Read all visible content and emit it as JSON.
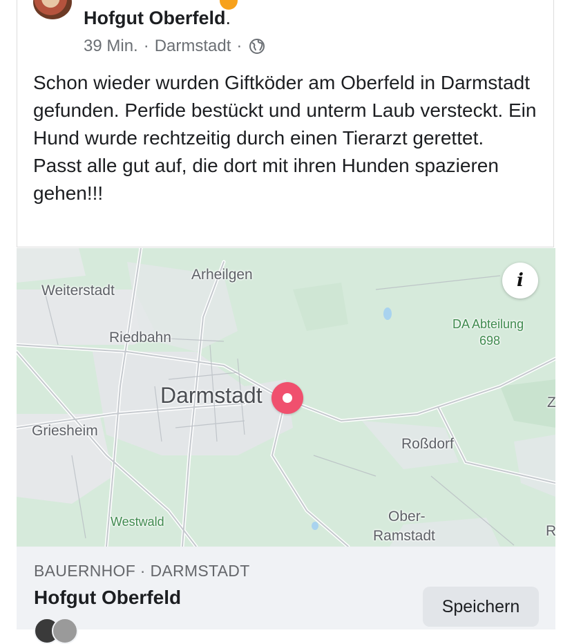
{
  "post": {
    "page_name": "Hofgut Oberfeld",
    "page_name_suffix": ".",
    "time": "39 Min.",
    "separator": "·",
    "location": "Darmstadt",
    "text": "Schon wieder wurden Giftköder am Oberfeld in Darmstadt gefunden. Perfide bestückt und unterm Laub versteckt. Ein Hund wurde rechtzeitig durch einen Tierarzt gerettet.\nPasst alle gut auf, die dort mit ihren Hunden spazieren gehen!!!"
  },
  "map": {
    "labels": {
      "weiterstadt": "Weiterstadt",
      "arheilgen": "Arheilgen",
      "riedbahn": "Riedbahn",
      "darmstadt": "Darmstadt",
      "griesheim": "Griesheim",
      "rossdorf": "Roßdorf",
      "westwald": "Westwald",
      "ober_ramstadt_1": "Ober-",
      "ober_ramstadt_2": "Ramstadt",
      "da_abteilung_1": "DA Abteilung",
      "da_abteilung_2": "698",
      "edge_z": "Z",
      "edge_r": "R"
    },
    "info_label": "i",
    "pin_color": "#f0506e",
    "land_color": "#d6eadb"
  },
  "place": {
    "category": "BAUERNHOF · DARMSTADT",
    "name": "Hofgut Oberfeld",
    "save_label": "Speichern"
  },
  "icons": {
    "globe": "globe-icon",
    "info": "info-icon",
    "pin": "map-pin-icon"
  }
}
